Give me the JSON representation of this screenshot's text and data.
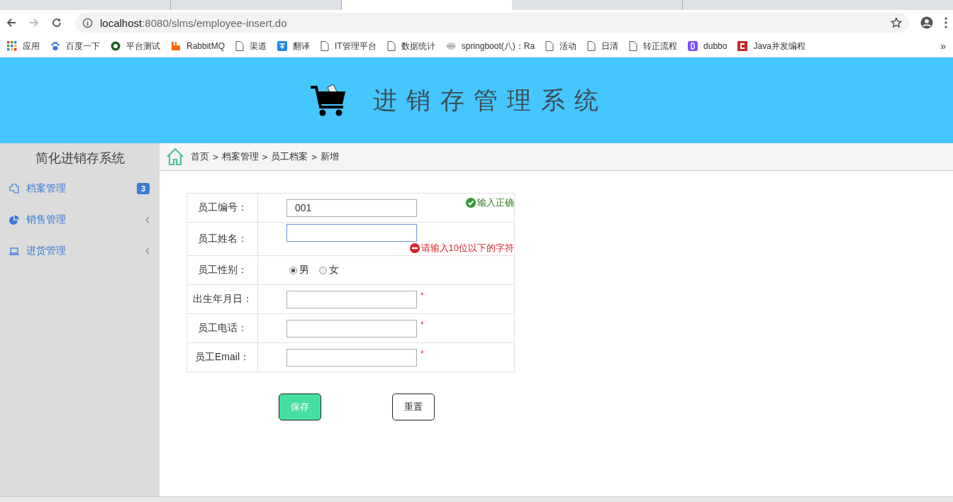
{
  "browser": {
    "tabs": [
      {
        "selected": false
      },
      {
        "selected": false
      },
      {
        "selected": true
      },
      {
        "selected": false
      }
    ],
    "address": {
      "host": "localhost",
      "path": ":8080/slms/employee-insert.do"
    },
    "bookmarks": [
      {
        "label": "应用"
      },
      {
        "label": "百度一下"
      },
      {
        "label": "平台测试"
      },
      {
        "label": "RabbitMQ"
      },
      {
        "label": "渠道"
      },
      {
        "label": "翻译"
      },
      {
        "label": "IT管理平台"
      },
      {
        "label": "数据统计"
      },
      {
        "label": "springboot(八)：Ra"
      },
      {
        "label": "活动"
      },
      {
        "label": "日清"
      },
      {
        "label": "转正流程"
      },
      {
        "label": "dubbo"
      },
      {
        "label": "Java并发编程"
      }
    ],
    "overflow": "»"
  },
  "header": {
    "title": "进 销 存 管 理 系 统"
  },
  "sidebar": {
    "title": "简化进销存系统",
    "items": [
      {
        "label": "档案管理",
        "badge": "3",
        "expanded": true
      },
      {
        "label": "销售管理",
        "expanded": false
      },
      {
        "label": "进货管理",
        "expanded": false
      }
    ]
  },
  "breadcrumb": [
    "首页",
    "档案管理",
    "员工档案",
    "新增"
  ],
  "breadcrumb_separator": ">",
  "form": {
    "rows": [
      {
        "kind": "text",
        "label": "员工编号：",
        "value": "001",
        "focused": false,
        "message": {
          "kind": "ok",
          "text": "输入正确"
        }
      },
      {
        "kind": "text",
        "label": "员工姓名：",
        "value": "",
        "focused": true,
        "message": {
          "kind": "error",
          "text": "请输入10位以下的字符"
        }
      },
      {
        "kind": "radio",
        "label": "员工性别：",
        "options": [
          {
            "label": "男",
            "selected": true
          },
          {
            "label": "女",
            "selected": false
          }
        ]
      },
      {
        "kind": "text",
        "label": "出生年月日：",
        "value": "",
        "focused": false,
        "required_mark": "*"
      },
      {
        "kind": "text",
        "label": "员工电话：",
        "value": "",
        "focused": false,
        "required_mark": "*"
      },
      {
        "kind": "text",
        "label": "员工Email：",
        "value": "",
        "focused": false,
        "required_mark": "*"
      }
    ],
    "buttons": [
      {
        "kind": "primary",
        "label": "保存"
      },
      {
        "kind": "default",
        "label": "重置"
      }
    ]
  }
}
